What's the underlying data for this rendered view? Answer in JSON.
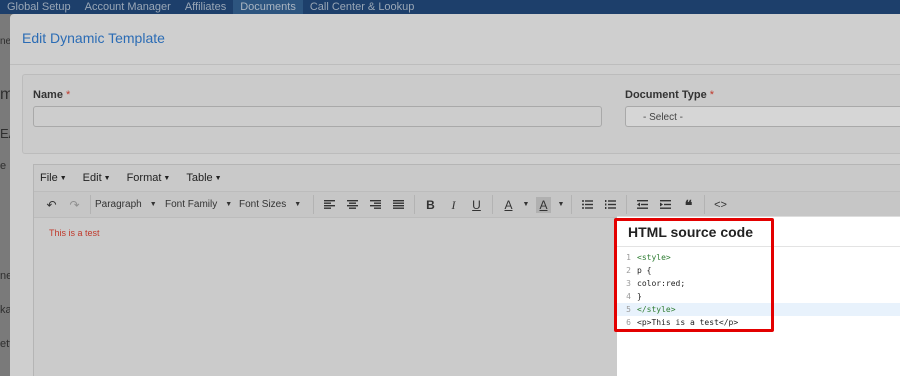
{
  "topnav": {
    "items": [
      "Global Setup",
      "Account Manager",
      "Affiliates",
      "Documents",
      "Call Center & Lookup"
    ],
    "active_index": 3
  },
  "background_fragments": [
    "ne",
    "m",
    "EA",
    "e",
    "ne",
    "ka",
    "ett"
  ],
  "modal": {
    "title": "Edit Dynamic Template"
  },
  "form": {
    "name_label": "Name",
    "name_value": "",
    "doctype_label": "Document Type",
    "required_mark": "*",
    "doctype_value": "- Select -"
  },
  "editor": {
    "menus": [
      "File",
      "Edit",
      "Format",
      "Table"
    ],
    "toolbar": {
      "paragraph": "Paragraph",
      "font_family": "Font Family",
      "font_sizes": "Font Sizes"
    },
    "content_text": "This is a test"
  },
  "source_panel": {
    "title": "HTML source code",
    "lines": [
      {
        "num": "1",
        "text": "<style>"
      },
      {
        "num": "2",
        "text": "p {"
      },
      {
        "num": "3",
        "text": "color:red;"
      },
      {
        "num": "4",
        "text": "}"
      },
      {
        "num": "5",
        "text": "</style>"
      },
      {
        "num": "6",
        "text": "<p>This is a test</p>"
      }
    ],
    "highlighted_line": "5"
  },
  "colors": {
    "title_blue": "#2b6cb5",
    "highlight_red": "#e30000",
    "content_red": "#c0392b"
  }
}
